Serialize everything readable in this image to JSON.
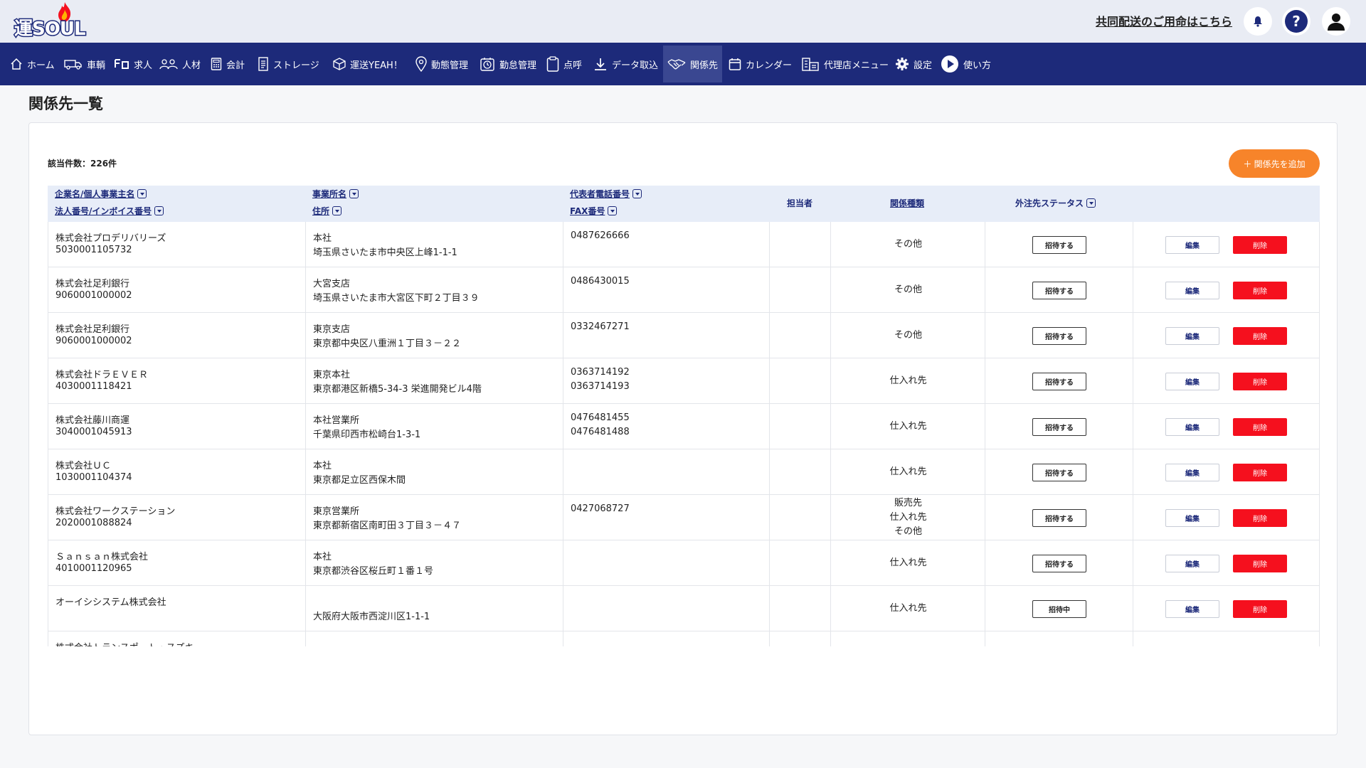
{
  "header": {
    "logo_text": "運SOUL",
    "kyodo_link": "共同配送のご用命はこちら"
  },
  "nav": [
    {
      "label": "ホーム",
      "icon": "home-icon"
    },
    {
      "label": "車輌",
      "icon": "truck-icon"
    },
    {
      "label": "求人",
      "icon": "job-icon"
    },
    {
      "label": "人材",
      "icon": "people-icon"
    },
    {
      "label": "会計",
      "icon": "calculator-icon"
    },
    {
      "label": "ストレージ",
      "icon": "document-icon"
    },
    {
      "label": "運送YEAH！",
      "icon": "box-icon"
    },
    {
      "label": "動態管理",
      "icon": "location-pin-icon"
    },
    {
      "label": "勤怠管理",
      "icon": "timecard-icon"
    },
    {
      "label": "点呼",
      "icon": "clipboard-icon"
    },
    {
      "label": "データ取込",
      "icon": "download-icon"
    },
    {
      "label": "関係先",
      "icon": "handshake-icon"
    },
    {
      "label": "カレンダー",
      "icon": "calendar-icon"
    },
    {
      "label": "代理店メニュー",
      "icon": "building-icon"
    },
    {
      "label": "設定",
      "icon": "gear-icon"
    },
    {
      "label": "使い方",
      "icon": "play-icon"
    }
  ],
  "page": {
    "title": "関係先一覧",
    "count_label": "該当件数：226件",
    "add_button": "＋ 関係先を追加"
  },
  "table": {
    "headers": {
      "company": "企業名/個人事業主名",
      "corp_no": "法人番号/インボイス番号",
      "office": "事業所名",
      "address": "住所",
      "phone": "代表者電話番号",
      "fax": "FAX番号",
      "person": "担当者",
      "kind": "関係種類",
      "status": "外注先ステータス"
    },
    "edit_label": "編集",
    "delete_label": "削除",
    "rows": [
      {
        "company": "株式会社プロデリバリーズ",
        "corp_no": "5030001105732",
        "office": "本社",
        "address": "埼玉県さいたま市中央区上峰1-1-1",
        "phone": "0487626666",
        "fax": "",
        "kind": [
          "その他"
        ],
        "status": "招待する"
      },
      {
        "company": "株式会社足利銀行",
        "corp_no": "9060001000002",
        "office": "大宮支店",
        "address": "埼玉県さいたま市大宮区下町２丁目３９",
        "phone": "0486430015",
        "fax": "",
        "kind": [
          "その他"
        ],
        "status": "招待する"
      },
      {
        "company": "株式会社足利銀行",
        "corp_no": "9060001000002",
        "office": "東京支店",
        "address": "東京都中央区八重洲１丁目３－２２",
        "phone": "0332467271",
        "fax": "",
        "kind": [
          "その他"
        ],
        "status": "招待する"
      },
      {
        "company": "株式会社ドラＥＶＥＲ",
        "corp_no": "4030001118421",
        "office": "東京本社",
        "address": "東京都港区新橋5-34-3 栄進開発ビル4階",
        "phone": "0363714192",
        "fax": "0363714193",
        "kind": [
          "仕入れ先"
        ],
        "status": "招待する"
      },
      {
        "company": "株式会社藤川商運",
        "corp_no": "3040001045913",
        "office": "本社営業所",
        "address": "千葉県印西市松崎台1-3-1",
        "phone": "0476481455",
        "fax": "0476481488",
        "kind": [
          "仕入れ先"
        ],
        "status": "招待する"
      },
      {
        "company": "株式会社ＵＣ",
        "corp_no": "1030001104374",
        "office": "本社",
        "address": "東京都足立区西保木間",
        "phone": "",
        "fax": "",
        "kind": [
          "仕入れ先"
        ],
        "status": "招待する"
      },
      {
        "company": "株式会社ワークステーション",
        "corp_no": "2020001088824",
        "office": "東京営業所",
        "address": "東京都新宿区南町田３丁目３－４７",
        "phone": "0427068727",
        "fax": "",
        "kind": [
          "販売先",
          "仕入れ先",
          "その他"
        ],
        "status": "招待する"
      },
      {
        "company": "Ｓａｎｓａｎ株式会社",
        "corp_no": "4010001120965",
        "office": "本社",
        "address": "東京都渋谷区桜丘町１番１号",
        "phone": "",
        "fax": "",
        "kind": [
          "仕入れ先"
        ],
        "status": "招待する"
      },
      {
        "company": "オーイシシステム株式会社",
        "corp_no": "",
        "office": "",
        "address": "大阪府大阪市西淀川区1-1-1",
        "phone": "",
        "fax": "",
        "kind": [
          "仕入れ先"
        ],
        "status": "招待中"
      },
      {
        "company": "株式会社トランスポート・スズキ",
        "corp_no": "",
        "office": "",
        "address": "",
        "phone": "",
        "fax": "",
        "kind": [],
        "status": ""
      }
    ]
  },
  "colors": {
    "nav_bg": "#1d2a7a",
    "header_bg": "#e9ecf4",
    "accent_orange": "#f7842a",
    "delete_red": "#f5101e"
  }
}
